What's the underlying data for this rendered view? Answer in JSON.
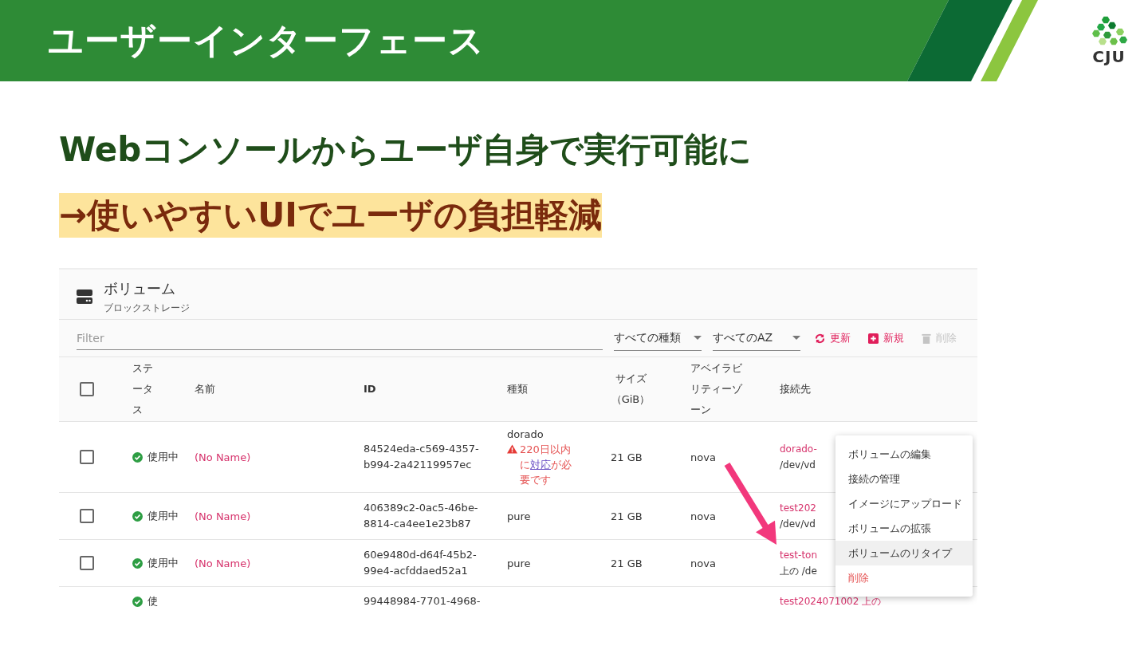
{
  "header": {
    "title": "ユーザーインターフェース",
    "logo": "CJU"
  },
  "heading": "Webコンソールからユーザ自身で実行可能に",
  "subheading": "→使いやすいUIでユーザの負担軽減",
  "panel": {
    "title": "ボリューム",
    "subtitle": "ブロックストレージ",
    "filter": {
      "placeholder": "Filter"
    },
    "selects": [
      "すべての種類",
      "すべてのAZ"
    ],
    "actions": [
      {
        "label": "更新",
        "kind": "refresh",
        "disabled": false
      },
      {
        "label": "新規",
        "kind": "new",
        "disabled": false
      },
      {
        "label": "削除",
        "kind": "delete",
        "disabled": true
      }
    ],
    "columns": [
      "ステータス",
      "名前",
      "ID",
      "種類",
      "サイズ（GiB）",
      "アベイラビリティーゾーン",
      "接続先"
    ],
    "select_all": {
      "checked": false
    },
    "rows": [
      {
        "checked": false,
        "status": "使用中",
        "name": "(No Name)",
        "id": "84524eda-c569-4357-b994-2a42119957ec",
        "type": "dorado",
        "warning": {
          "before": "220日以内に",
          "link": "対応",
          "after": "が必要です"
        },
        "size": "21 GB",
        "zone": "nova",
        "connection": [
          "dorado-",
          "/dev/vd"
        ]
      },
      {
        "checked": false,
        "status": "使用中",
        "name": "(No Name)",
        "id": "406389c2-0ac5-46be-8814-ca4ee1e23b87",
        "type": "pure",
        "size": "21 GB",
        "zone": "nova",
        "connection": [
          "test202",
          "/dev/vd"
        ]
      },
      {
        "checked": false,
        "status": "使用中",
        "name": "(No Name)",
        "id": "60e9480d-d64f-45b2-99e4-acfddaed52a1",
        "type": "pure",
        "size": "21 GB",
        "zone": "nova",
        "connection": [
          "test-ton",
          "上の /de"
        ]
      }
    ],
    "cut_row": {
      "status": "使",
      "id": "99448984-7701-4968-",
      "connection": "test2024071002 上の"
    },
    "menu": [
      {
        "label": "ボリュームの編集",
        "kind": "normal",
        "selected": false
      },
      {
        "label": "接続の管理",
        "kind": "normal",
        "selected": false
      },
      {
        "label": "イメージにアップロード",
        "kind": "normal",
        "selected": false
      },
      {
        "label": "ボリュームの拡張",
        "kind": "normal",
        "selected": false
      },
      {
        "label": "ボリュームのリタイプ",
        "kind": "normal",
        "selected": true
      },
      {
        "label": "削除",
        "kind": "danger",
        "selected": false
      }
    ]
  }
}
